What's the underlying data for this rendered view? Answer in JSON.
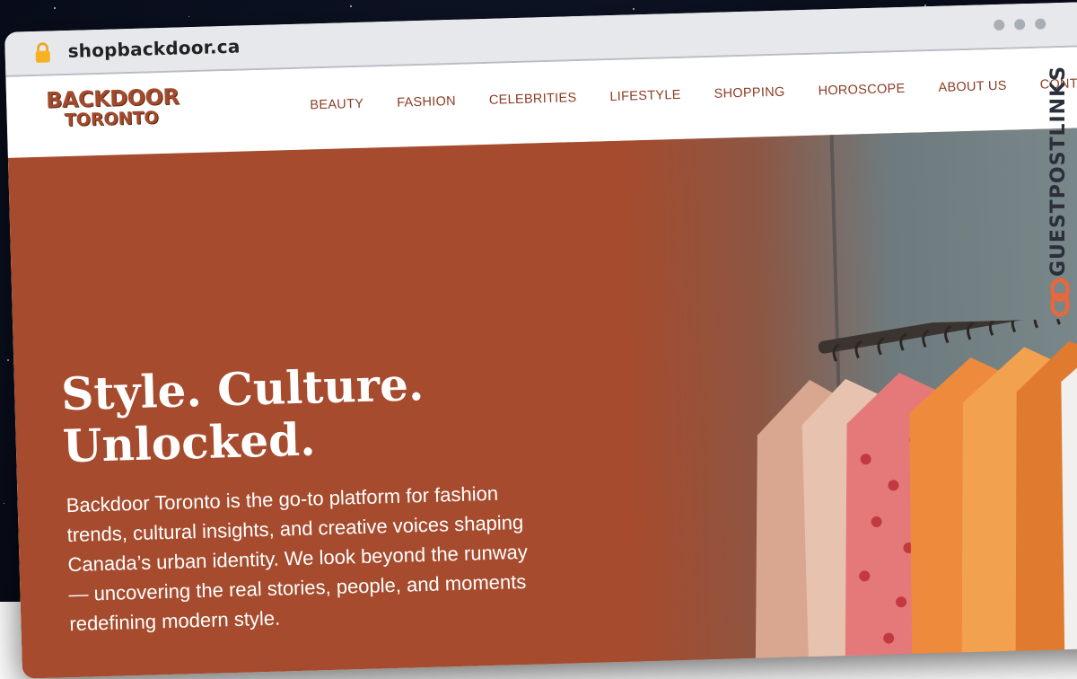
{
  "browser": {
    "url": "shopbackdoor.ca",
    "lock_icon": "lock-icon",
    "window_controls": [
      "window-dot",
      "window-dot",
      "window-dot"
    ]
  },
  "site": {
    "logo": {
      "line1": "BACKDOOR",
      "line2": "TORONTO"
    },
    "nav": [
      {
        "label": "BEAUTY"
      },
      {
        "label": "FASHION"
      },
      {
        "label": "CELEBRITIES"
      },
      {
        "label": "LIFESTYLE"
      },
      {
        "label": "SHOPPING"
      },
      {
        "label": "HOROSCOPE"
      },
      {
        "label": "ABOUT US"
      },
      {
        "label": "CONTACT"
      }
    ]
  },
  "hero": {
    "title_line1": "Style. Culture.",
    "title_line2": "Unlocked.",
    "description": "Backdoor Toronto is the go-to platform for fashion trends, cultural insights, and creative voices shaping Canada’s urban identity. We look beyond the runway — uncovering the real stories, people, and moments redefining modern style."
  },
  "watermark": {
    "text": "GUESTPOSTLINKS"
  },
  "colors": {
    "brand": "#a24a2b",
    "hero_bg": "#a64b2d",
    "nav_text": "#8a3d24",
    "watermark_accent": "#e8673c"
  }
}
